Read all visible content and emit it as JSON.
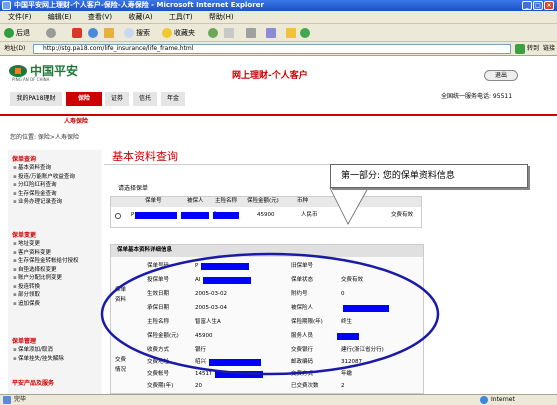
{
  "window": {
    "title": "中国平安网上理财-个人客户-保险-人寿保险 - Microsoft Internet Explorer"
  },
  "menu": [
    "文件(F)",
    "编辑(E)",
    "查看(V)",
    "收藏(A)",
    "工具(T)",
    "帮助(H)"
  ],
  "toolbar": {
    "back": "后退",
    "search": "搜索",
    "favorites": "收藏夹"
  },
  "address": {
    "label": "地址(D)",
    "url": "http://stg.pa18.com/life_insurance/life_frame.html",
    "go": "转到",
    "links": "链接"
  },
  "header": {
    "logo_cn": "中国平安",
    "logo_en": "PING AN OF CHINA",
    "banner": "网上理财-个人客户",
    "logout": "退出",
    "hotline": "全国统一服务电话: 95511"
  },
  "nav": {
    "tabs": [
      "我的PA18理财",
      "保险",
      "证券",
      "信托",
      "年金"
    ],
    "subtab": "人寿保险"
  },
  "breadcrumb": "您的位置: 保险>人寿保险",
  "sidebar": {
    "sections": [
      {
        "title": "保单查询",
        "items": [
          "基本资料查询",
          "投连/万能账户收益查询",
          "分红险红利查询",
          "生存保险金查询",
          "业务办理记录查询"
        ]
      },
      {
        "title": "保单变更",
        "items": [
          "地址变更",
          "客户资料变更",
          "生存保险金转帐给付授权",
          "自垫选择权变更",
          "账户分配比例变更",
          "投连转换",
          "部分领取",
          "追加保费"
        ]
      },
      {
        "title": "保单管理",
        "items": [
          "保单添加/取消",
          "保单挂失/挂失解除"
        ]
      },
      {
        "title": "平安产品及服务",
        "items": []
      }
    ]
  },
  "main": {
    "title": "基本资料查询",
    "select_label": "请选择保单",
    "policy_table": {
      "headers": [
        "保单号",
        "被保人",
        "主险名称",
        "保险金额(元)",
        "币种"
      ],
      "row": {
        "policy_no": "P",
        "insured": "",
        "product": "生A",
        "amount": "45900",
        "currency": "人民币",
        "status": "交费有效"
      }
    },
    "detail_title": "保单基本资料详细信息",
    "detail": {
      "section_label": "保单资料",
      "rows": [
        {
          "l1": "保单号码",
          "v1": "P",
          "l2": "旧保单号",
          "v2": ""
        },
        {
          "l1": "投保单号",
          "v1": "AI",
          "l2": "保单状态",
          "v2": "交费有效"
        },
        {
          "l1": "生效日期",
          "v1": "2005-03-02",
          "l2": "附约号",
          "v2": "0"
        },
        {
          "l1": "承保日期",
          "v1": "2005-03-04",
          "l2": "被保险人",
          "v2": ""
        },
        {
          "l1": "主险名称",
          "v1": "智富人生A",
          "l2": "保险期限(年)",
          "v2": "终生"
        },
        {
          "l1": "保险金额(元)",
          "v1": "45900",
          "l2": "服务人员",
          "v2": ""
        }
      ],
      "pay_label": "交费情况",
      "pay_rows": [
        {
          "l1": "收费方式",
          "v1": "银行",
          "l2": "交费银行",
          "v2": "建行(浙江省分行)"
        },
        {
          "l1": "交费地址",
          "v1": "绍兴",
          "l2": "邮政编码",
          "v2": "312087"
        },
        {
          "l1": "交费帐号",
          "v1": "1451T",
          "l2": "交费方式",
          "v2": "年缴"
        },
        {
          "l1": "交费期(年)",
          "v1": "20",
          "l2": "已交费次数",
          "v2": "2"
        }
      ]
    },
    "callout": "第一部分: 您的保单资料信息"
  },
  "status": {
    "text": "完毕",
    "zone": "Internet"
  },
  "colors": {
    "brand_red": "#cc0000",
    "brand_green": "#1d7a3a",
    "redact": "#0000ff",
    "ellipse": "#1a1aa8"
  }
}
